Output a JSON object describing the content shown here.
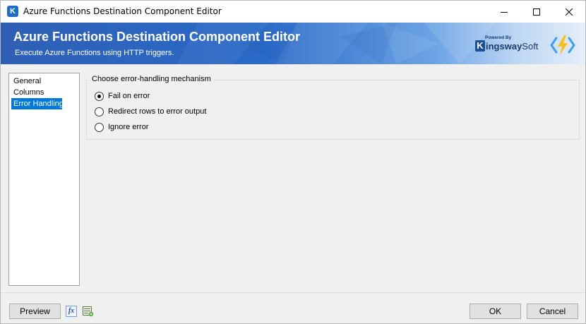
{
  "window": {
    "title": "Azure Functions Destination Component Editor",
    "app_icon_letter": "K"
  },
  "banner": {
    "title": "Azure Functions Destination Component Editor",
    "subtitle": "Execute Azure Functions using HTTP triggers.",
    "logo": {
      "powered_by": "Powered By",
      "brand_k": "K",
      "brand_word": "ingsway",
      "brand_soft": "Soft"
    },
    "icon": "azure-functions-icon"
  },
  "nav": {
    "items": [
      {
        "label": "General",
        "selected": false
      },
      {
        "label": "Columns",
        "selected": false
      },
      {
        "label": "Error Handling",
        "selected": true
      }
    ]
  },
  "error_handling": {
    "group_label": "Choose error-handling mechanism",
    "options": [
      {
        "label": "Fail on error",
        "checked": true
      },
      {
        "label": "Redirect rows to error output",
        "checked": false
      },
      {
        "label": "Ignore error",
        "checked": false
      }
    ]
  },
  "footer": {
    "preview_label": "Preview",
    "fx_label": "fx",
    "ok_label": "OK",
    "cancel_label": "Cancel"
  },
  "colors": {
    "selection": "#0078d7",
    "banner_start": "#2f5fb5",
    "banner_end": "#e6eef9"
  }
}
